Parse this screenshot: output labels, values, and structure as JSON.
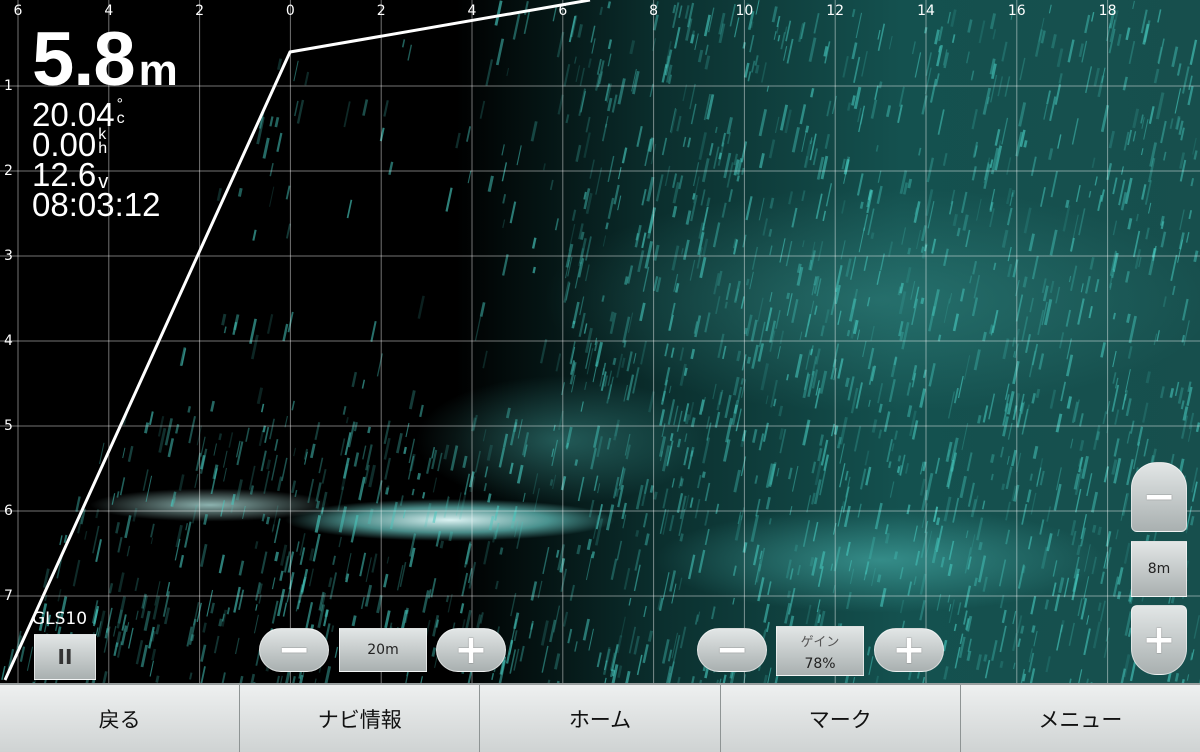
{
  "readouts": {
    "depth_value": "5.8",
    "depth_unit": "m",
    "temperature_value": "20.04",
    "temperature_unit_top": "°",
    "temperature_unit_bottom": "c",
    "speed_value": "0.00",
    "speed_unit_top": "k",
    "speed_unit_bottom": "h",
    "voltage_value": "12.6",
    "voltage_unit": "v",
    "time": "08:03:12"
  },
  "x_axis_labels": [
    "6",
    "4",
    "2",
    "0",
    "2",
    "4",
    "6",
    "8",
    "10",
    "12",
    "14",
    "16",
    "18"
  ],
  "y_axis_labels": [
    "1",
    "2",
    "3",
    "4",
    "5",
    "6",
    "7"
  ],
  "sonar_colors": {
    "background": "#000000",
    "echo": "#2fb3ab",
    "bottom_return": "#e8ffff",
    "beam_line": "#ffffff"
  },
  "device_label": "GLS10",
  "pause_button": {
    "icon": "pause-icon",
    "label": "II"
  },
  "range_control": {
    "minus": "−",
    "value": "20m",
    "plus": "+"
  },
  "gain_control": {
    "minus": "−",
    "label": "ゲイン",
    "value": "78%",
    "plus": "+"
  },
  "zoom_control": {
    "minus": "−",
    "value": "8m",
    "plus": "+"
  },
  "nav_buttons": [
    "戻る",
    "ナビ情報",
    "ホーム",
    "マーク",
    "メニュー"
  ]
}
